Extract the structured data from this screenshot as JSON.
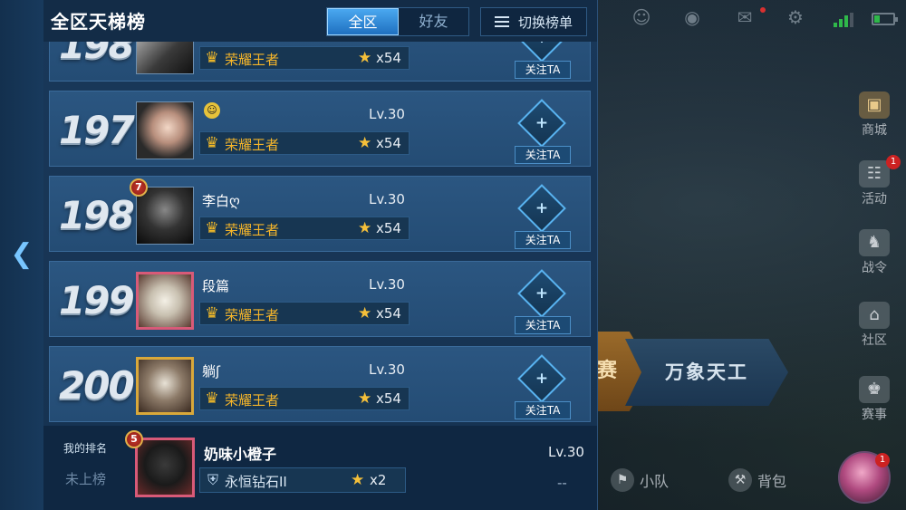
{
  "header": {
    "title": "全区天梯榜",
    "tabs": [
      {
        "label": "全区",
        "active": true
      },
      {
        "label": "好友",
        "active": false
      }
    ],
    "switch_label": "切换榜单"
  },
  "rows": [
    {
      "rank": "198",
      "name": "",
      "level": "",
      "tier": "荣耀王者",
      "stars": "x54",
      "follow": "关注TA",
      "badge": ""
    },
    {
      "rank": "197",
      "name": "",
      "level": "Lv.30",
      "tier": "荣耀王者",
      "stars": "x54",
      "follow": "关注TA",
      "badge": ""
    },
    {
      "rank": "198",
      "name": "李白ღ",
      "level": "Lv.30",
      "tier": "荣耀王者",
      "stars": "x54",
      "follow": "关注TA",
      "badge": "7"
    },
    {
      "rank": "199",
      "name": "段篇",
      "level": "Lv.30",
      "tier": "荣耀王者",
      "stars": "x54",
      "follow": "关注TA",
      "badge": ""
    },
    {
      "rank": "200",
      "name": "躺ʃ",
      "level": "Lv.30",
      "tier": "荣耀王者",
      "stars": "x54",
      "follow": "关注TA",
      "badge": ""
    }
  ],
  "my_rank": {
    "label": "我的排名",
    "status": "未上榜",
    "badge": "5",
    "name": "奶味小橙子",
    "level": "Lv.30",
    "tier": "永恒钻石II",
    "stars": "x2",
    "follow": "--"
  },
  "side_menu": [
    {
      "label": "商城",
      "icon": "shop-icon"
    },
    {
      "label": "活动",
      "icon": "event-icon",
      "badge": "1"
    },
    {
      "label": "战令",
      "icon": "pass-icon"
    },
    {
      "label": "社区",
      "icon": "community-icon"
    },
    {
      "label": "赛事",
      "icon": "trophy-icon"
    }
  ],
  "mode": {
    "prev": "赛",
    "current": "万象天工"
  },
  "bottom_bar": {
    "team": "小队",
    "bag": "背包",
    "hero_badge": "1"
  },
  "colors": {
    "panel": "#19385a",
    "row": "#2b5681",
    "accent": "#4aa8f0",
    "tier_gold": "#f5b52a"
  }
}
